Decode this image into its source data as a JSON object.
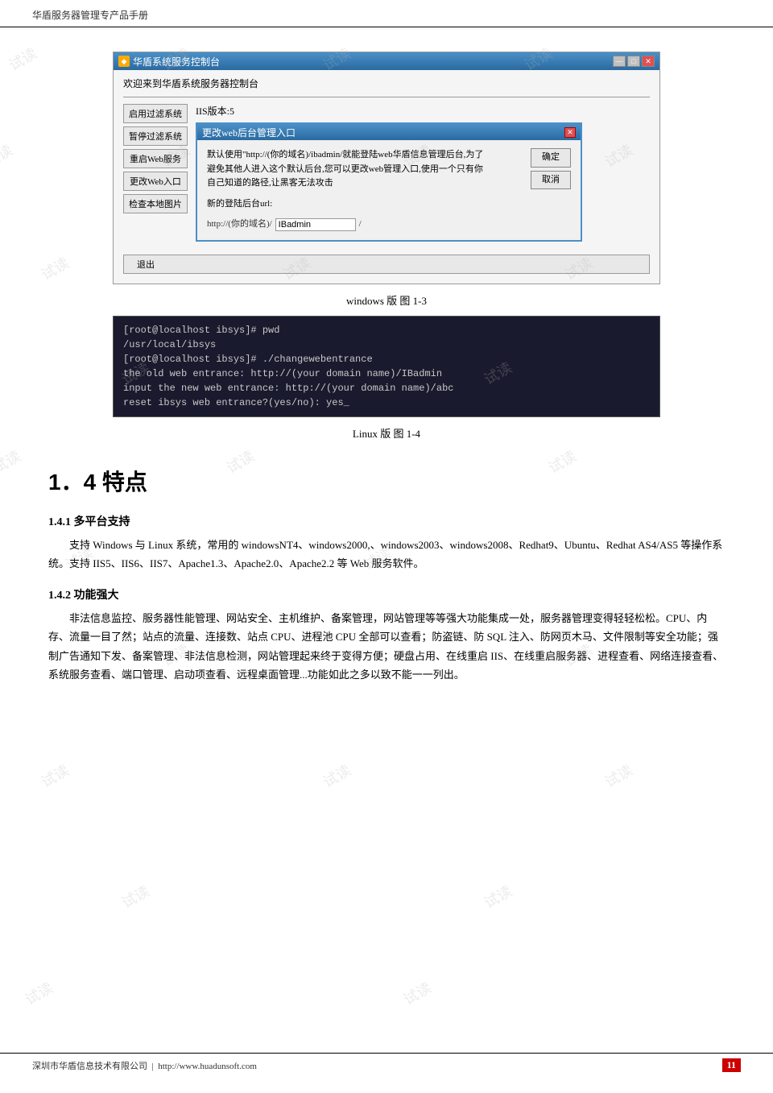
{
  "header": {
    "title": "华盾服务器管理专产品手册"
  },
  "windows_screenshot": {
    "titlebar": "华盾系统服务控制台",
    "welcome_text": "欢迎来到华盾系统服务器控制台",
    "iis_info": "IIS版本:5",
    "buttons": {
      "enable_filter": "启用过滤系统",
      "disable_filter": "暂停过滤系统",
      "restart_web": "重启Web服务",
      "change_web": "更改Web入口",
      "check_images": "检查本地图片"
    },
    "dialog": {
      "title": "更改web后台管理入口",
      "description_line1": "默认使用\"http://(你的域名)/ibadmin/就能登陆web华盾信息管理后台,为了",
      "description_line2": "避免其他人进入这个默认后台,您可以更改web管理入口,使用一个只有你",
      "description_line3": "自己知道的路径,让黑客无法攻击",
      "new_url_label": "新的登陆后台url:",
      "url_prefix": "http://(你的域名)/",
      "url_input_value": "IBadmin",
      "url_suffix": "/",
      "ok_button": "确定",
      "cancel_button": "取消"
    },
    "quit_button": "退出"
  },
  "windows_caption": "windows 版  图 1-3",
  "terminal_screenshot": {
    "lines": [
      "[root@localhost ibsys]# pwd",
      "/usr/local/ibsys",
      "[root@localhost ibsys]# ./changewebentrance",
      "the old web entrance: http://(your domain name)/IBadmin",
      "input the new web entrance: http://(your domain name)/abc",
      "reset ibsys web entrance?(yes/no): yes_"
    ]
  },
  "linux_caption": "Linux 版  图 1-4",
  "section_14": {
    "heading": "1．4  特点",
    "subsection_141": {
      "title": "1.4.1 多平台支持",
      "content": "支持 Windows 与 Linux 系统，常用的 windowsNT4、windows2000,、windows2003、windows2008、Redhat9、Ubuntu、Redhat AS4/AS5 等操作系统。支持 IIS5、IIS6、IIS7、Apache1.3、Apache2.0、Apache2.2 等 Web 服务软件。"
    },
    "subsection_142": {
      "title": "1.4.2 功能强大",
      "content": "非法信息监控、服务器性能管理、网站安全、主机维护、备案管理，网站管理等等强大功能集成一处，服务器管理变得轻轻松松。CPU、内存、流量一目了然；站点的流量、连接数、站点 CPU、进程池 CPU 全部可以查看；防盗链、防 SQL 注入、防网页木马、文件限制等安全功能；强制广告通知下发、备案管理、非法信息检测，网站管理起来终于变得方便；硬盘占用、在线重启 IIS、在线重启服务器、进程查看、网络连接查看、系统服务查看、端口管理、启动项查看、远程桌面管理...功能如此之多以致不能一一列出。"
    }
  },
  "footer": {
    "company": "深圳市华盾信息技术有限公司",
    "website": "http://www.huadunsoft.com",
    "page_number": "11"
  },
  "watermark_text": "试读"
}
